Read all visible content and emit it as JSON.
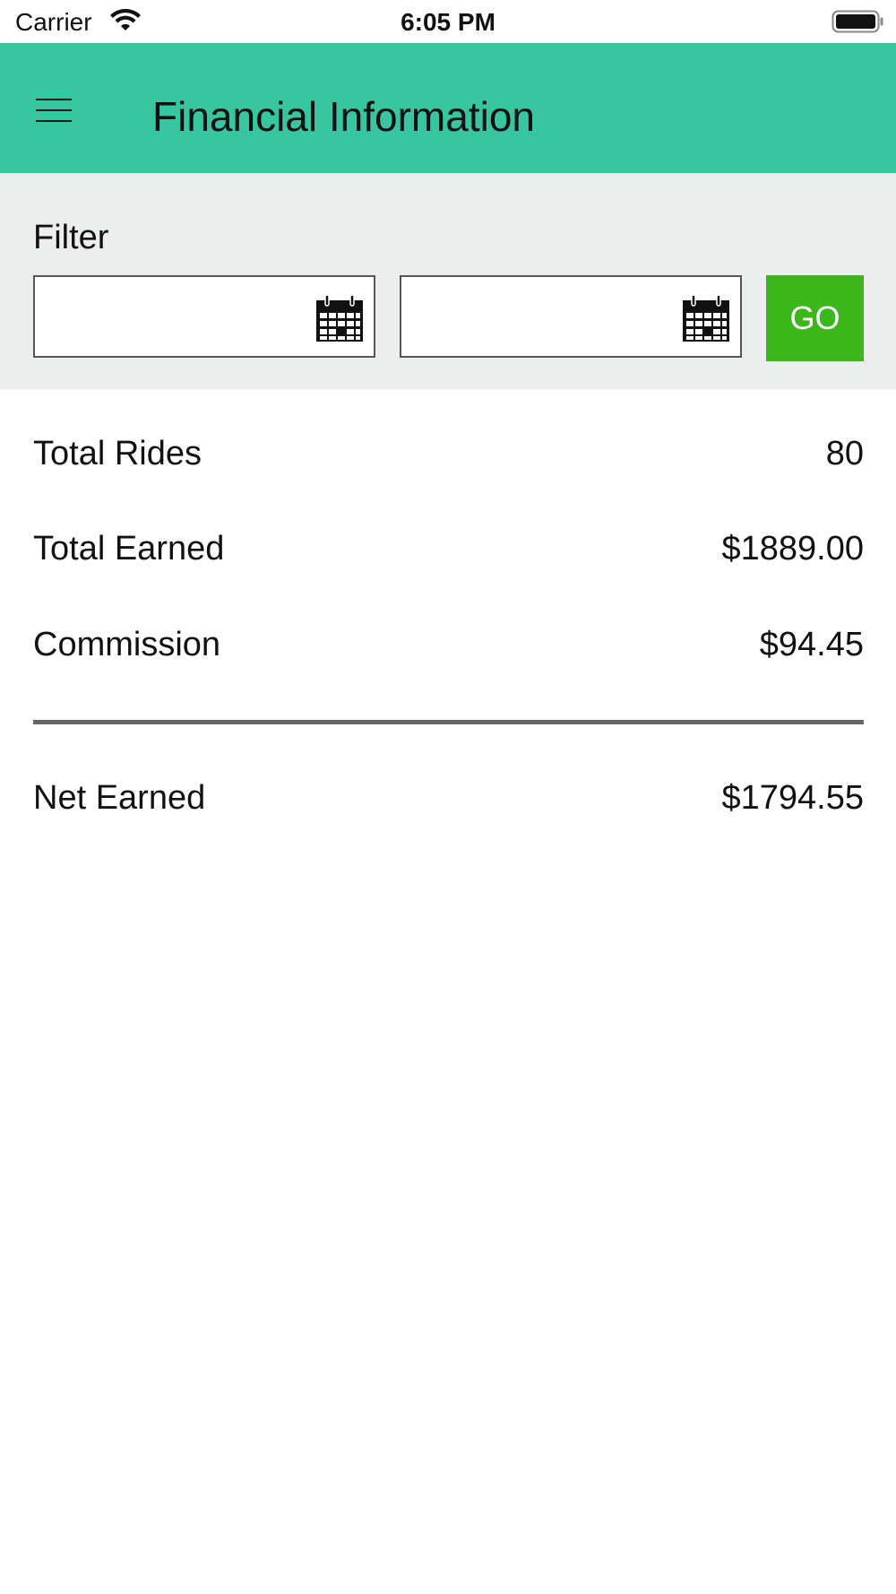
{
  "status_bar": {
    "carrier": "Carrier",
    "time": "6:05 PM",
    "icons": [
      "wifi-icon",
      "battery-icon"
    ]
  },
  "header": {
    "title": "Financial Information",
    "menu_icon": "hamburger-menu-icon",
    "background_color": "#38c6a1"
  },
  "filter": {
    "label": "Filter",
    "from_date": {
      "value": "",
      "placeholder": "",
      "icon": "calendar-icon"
    },
    "to_date": {
      "value": "",
      "placeholder": "",
      "icon": "calendar-icon"
    },
    "go_label": "GO",
    "go_color": "#3cb71b",
    "panel_color": "#eceded"
  },
  "summary": {
    "total_rides": {
      "label": "Total Rides",
      "value": "80"
    },
    "total_earned": {
      "label": "Total Earned",
      "value": "$1889.00"
    },
    "commission": {
      "label": "Commission",
      "value": "$94.45"
    },
    "net_earned": {
      "label": "Net Earned",
      "value": "$1794.55"
    }
  }
}
